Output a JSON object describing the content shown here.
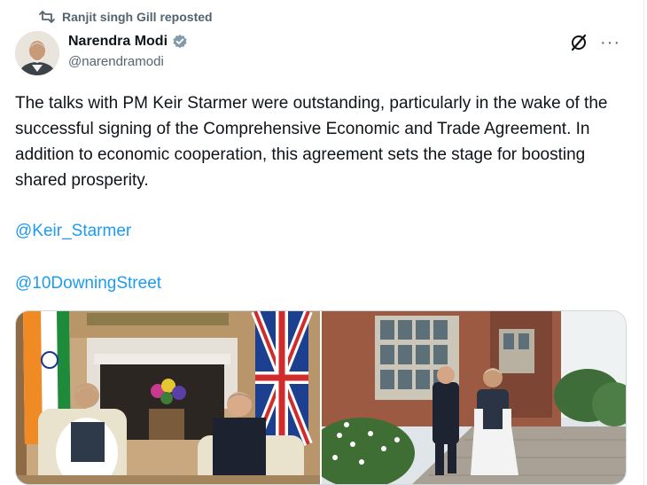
{
  "repost": {
    "icon": "repost-icon",
    "text": "Ranjit singh Gill reposted"
  },
  "author": {
    "name": "Narendra Modi",
    "handle": "@narendramodi",
    "verified_icon": "verified-badge-icon",
    "verified_color": "#829aab"
  },
  "actions": {
    "grok_icon": "grok-icon",
    "more_label": "···"
  },
  "tweet": {
    "text": "The talks with PM Keir Starmer were outstanding, particularly in the wake of the successful signing of the Comprehensive Economic and Trade Agreement. In addition to economic cooperation, this agreement sets the stage for boosting shared prosperity.",
    "mentions": [
      "@Keir_Starmer",
      "@10DowningStreet"
    ]
  },
  "colors": {
    "link": "#1d9bf0",
    "secondary_text": "#536471",
    "primary_text": "#0f1419"
  },
  "media": [
    {
      "description_icon": "photo-meeting-icon"
    },
    {
      "description_icon": "photo-walking-icon"
    }
  ]
}
